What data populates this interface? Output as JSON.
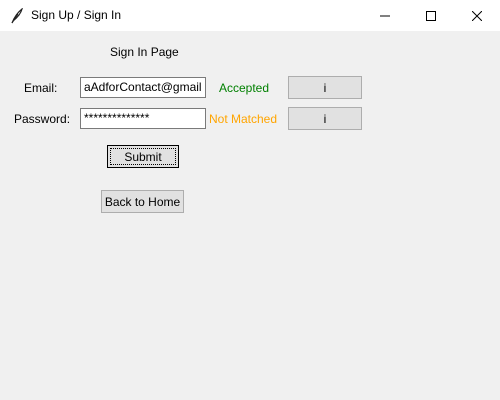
{
  "window": {
    "title": "Sign Up / Sign In",
    "icons": {
      "app": "feather-icon",
      "minimize": "minimize-icon",
      "maximize": "maximize-icon",
      "close": "close-icon"
    }
  },
  "page": {
    "heading": "Sign In Page"
  },
  "email": {
    "label": "Email:",
    "value": "aAdforContact@gmail",
    "status": "Accepted",
    "status_color": "#008000",
    "info_label": "i"
  },
  "password": {
    "label": "Password:",
    "value": "**************",
    "status": "Not Matched",
    "status_color": "#ffa500",
    "info_label": "i"
  },
  "buttons": {
    "submit": "Submit",
    "back": "Back to Home"
  }
}
